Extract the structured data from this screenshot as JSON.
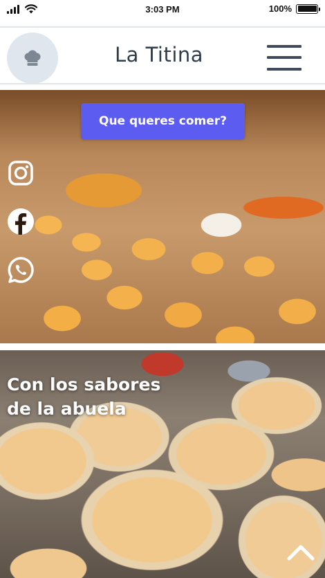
{
  "status_bar": {
    "time": "3:03 PM",
    "battery": "100%",
    "icons": [
      "signal-icon",
      "wifi-icon",
      "battery-icon"
    ]
  },
  "header": {
    "logo_icon": "chef-hat-icon",
    "brand": "La Titina",
    "menu_icon": "hamburger-menu-icon"
  },
  "hero1": {
    "cta_label": "Que queres comer?",
    "social_icons": [
      "instagram-icon",
      "facebook-icon",
      "whatsapp-icon"
    ]
  },
  "hero2": {
    "title_line1": "Con los sabores",
    "title_line2": "de la abuela",
    "scroll_icon": "chevron-up-icon"
  },
  "colors": {
    "accent": "#5d5cf0",
    "brand_text": "#2f3c4d",
    "logo_bg": "#dfe6ed"
  }
}
